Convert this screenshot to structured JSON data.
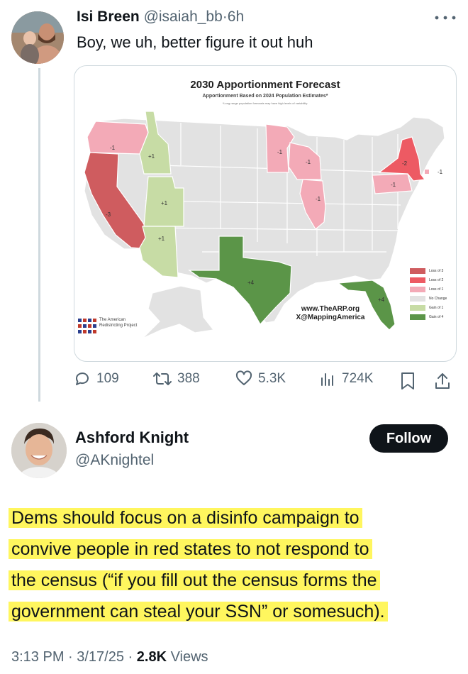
{
  "tweet1": {
    "name": "Isi Breen",
    "handle": "@isaiah_bb",
    "separator": "·",
    "time": "6h",
    "text": "Boy, we uh, better figure it out huh",
    "stats": {
      "replies": "109",
      "reposts": "388",
      "likes": "5.3K",
      "views": "724K"
    }
  },
  "map_image": {
    "title": "2030 Apportionment Forecast",
    "subtitle": "Apportionment Based on 2024 Population Estimates*",
    "note": "*Long-range population forecasts may have high levels of variability.",
    "url": "www.TheARP.org",
    "social": "X@MappingAmerica",
    "org_name": "The American Redistricting Project",
    "legend": [
      {
        "label": "Loss of 3",
        "color": "#cf5c5f"
      },
      {
        "label": "Loss of 2",
        "color": "#ed5a63"
      },
      {
        "label": "Loss of 1",
        "color": "#f3aab7"
      },
      {
        "label": "No Change",
        "color": "#e2e2e2"
      },
      {
        "label": "Gain of 1",
        "color": "#c7dca5"
      },
      {
        "label": "Gain of 4",
        "color": "#5b9548"
      }
    ],
    "state_labels": {
      "oregon": "-1",
      "idaho": "+1",
      "utah": "+1",
      "arizona": "+1",
      "california": "-3",
      "texas": "+4",
      "florida": "+4",
      "minnesota": "-1",
      "wisconsin": "-1",
      "illinois": "-1",
      "pennsylvania": "-1",
      "new_york": "-2",
      "rhode_island": "-1"
    }
  },
  "tweet2": {
    "name": "Ashford Knight",
    "handle": "@AKnightel",
    "follow_label": "Follow",
    "lines": [
      "Dems should focus on a disinfo campaign to",
      "convive people in red states to not respond to",
      "the census (“if you fill out the census forms the",
      "government can steal your SSN” or somesuch)."
    ],
    "timestamp": "3:13 PM · 3/17/25 · ",
    "views_count": "2.8K",
    "views_label": " Views"
  },
  "colors": {
    "highlight": "#fff65e",
    "secondary_text": "#536471",
    "thread_line": "#cfd9de"
  }
}
